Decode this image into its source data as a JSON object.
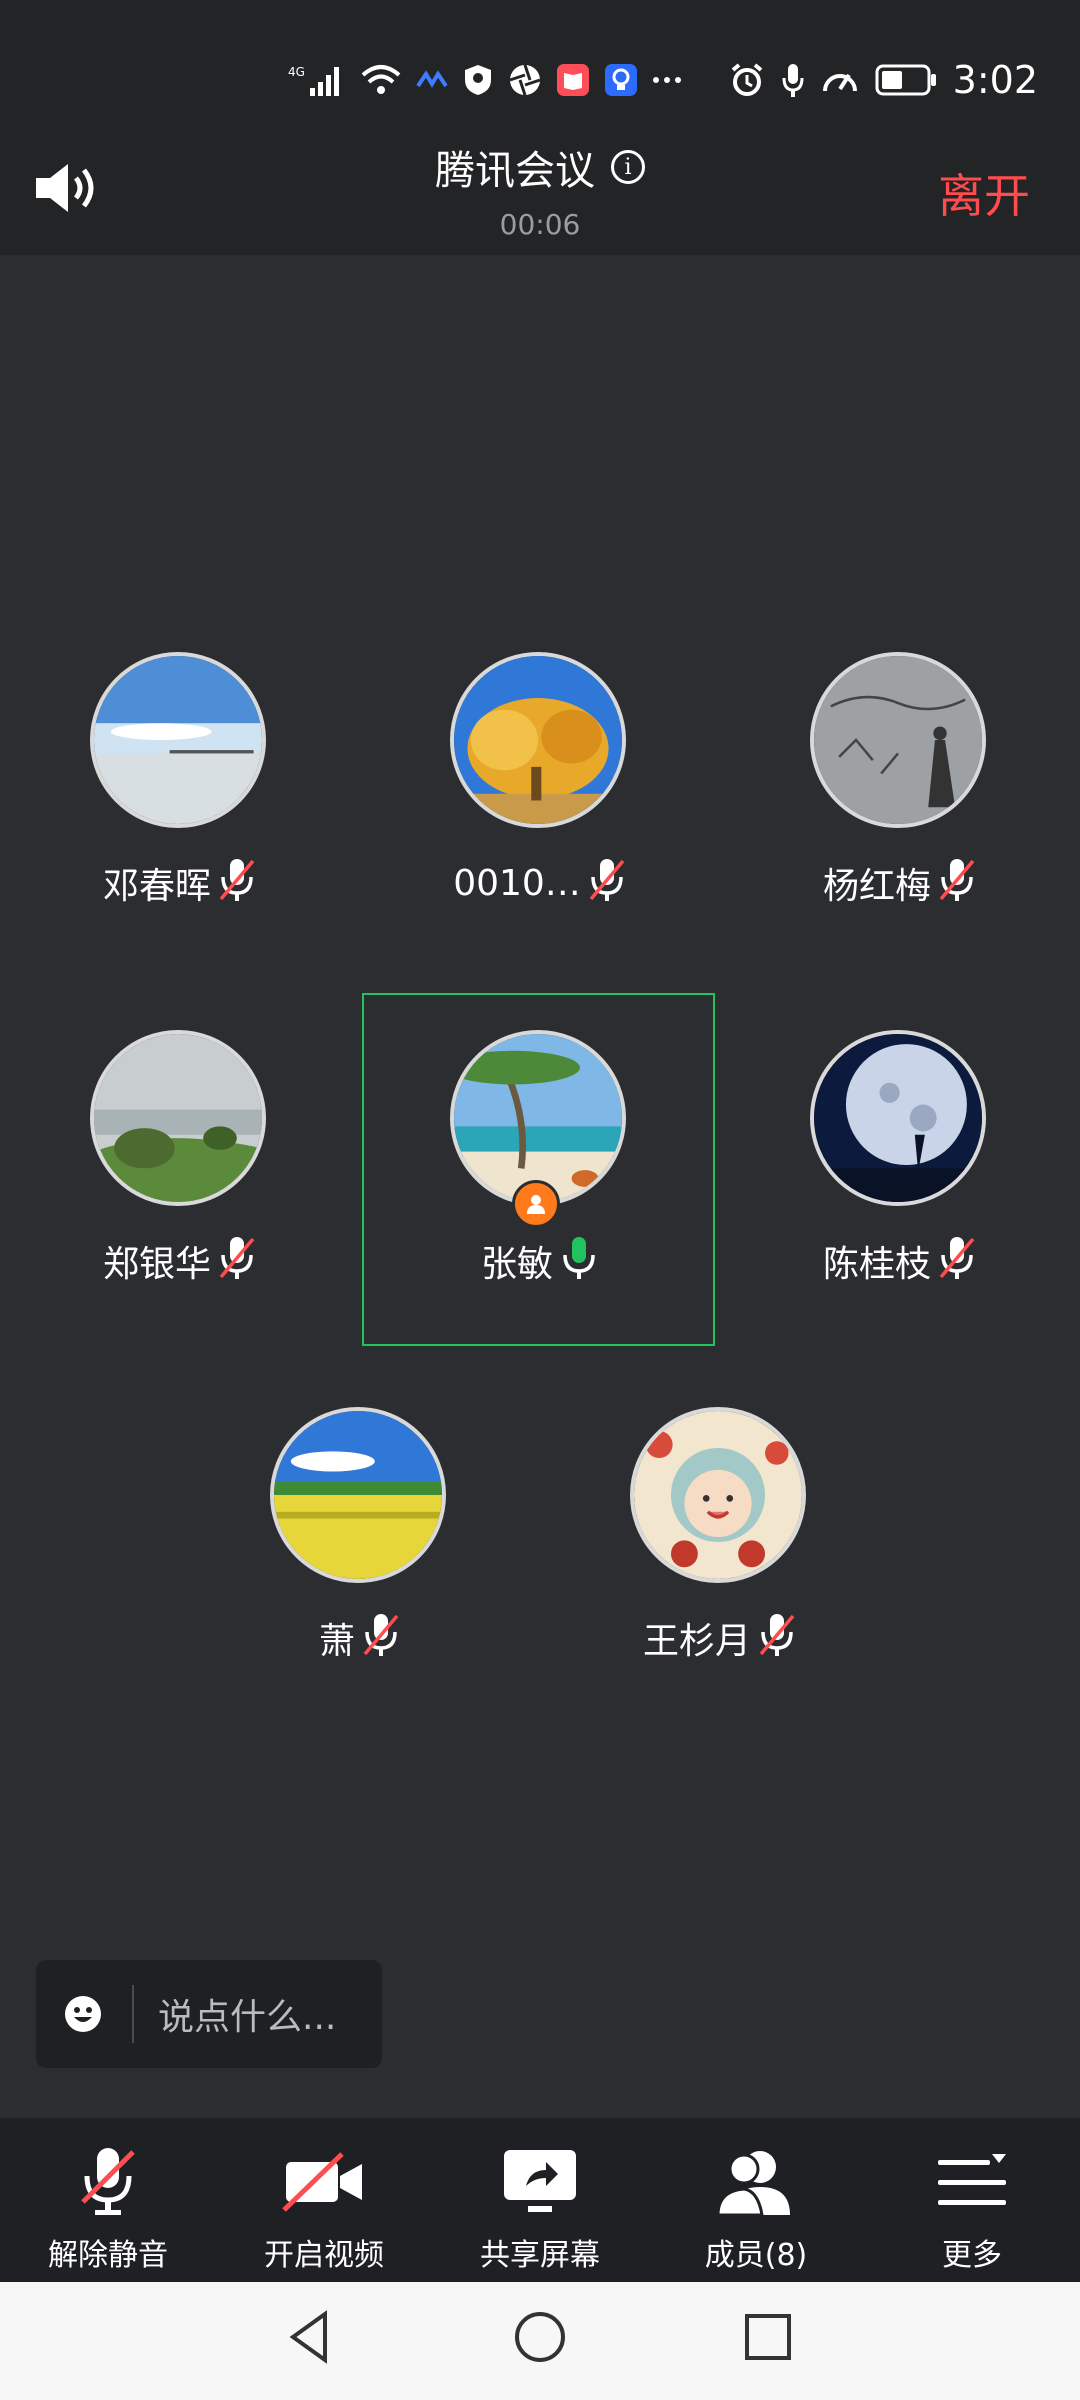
{
  "status_bar": {
    "time": "3:02",
    "network": "4G",
    "icons": [
      "signal-icon",
      "wifi-icon",
      "swiftkey-icon",
      "shield-icon",
      "aperture-icon",
      "book-icon",
      "bulb-icon",
      "more-icon",
      "alarm-icon",
      "mic-icon",
      "speed-icon",
      "battery-icon"
    ]
  },
  "header": {
    "title": "腾讯会议",
    "timer": "00:06",
    "leave_label": "离开"
  },
  "participants": [
    {
      "name": "邓春晖",
      "muted": true,
      "avatar": "beach-pier"
    },
    {
      "name": "0010…",
      "muted": true,
      "avatar": "golden-tree"
    },
    {
      "name": "杨红梅",
      "muted": true,
      "avatar": "ink-sketch"
    },
    {
      "name": "郑银华",
      "muted": true,
      "avatar": "misty-hill"
    },
    {
      "name": "张敏",
      "muted": false,
      "host": true,
      "speaking": true,
      "avatar": "tropical-beach"
    },
    {
      "name": "陈桂枝",
      "muted": true,
      "avatar": "moon-night"
    },
    {
      "name": "萧",
      "muted": true,
      "avatar": "rapeseed-field"
    },
    {
      "name": "王杉月",
      "muted": true,
      "avatar": "cartoon-girl"
    }
  ],
  "chat": {
    "placeholder": "说点什么..."
  },
  "toolbar": {
    "unmute_label": "解除静音",
    "video_label": "开启视频",
    "share_label": "共享屏幕",
    "members_label": "成员(8)",
    "more_label": "更多"
  },
  "colors": {
    "background": "#2b2d31",
    "leave": "#ff4d4f",
    "active_border": "#22c35e",
    "mic_active": "#22c35e",
    "muted_slash": "#ff4d4f",
    "host_badge": "#ff7a1a"
  }
}
